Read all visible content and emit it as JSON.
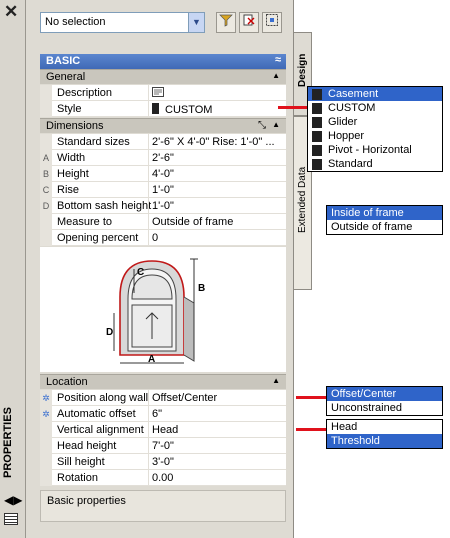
{
  "palette": {
    "header_blue": "#4a76c4",
    "highlight": "#2f64c9",
    "callout_red": "#e0121c",
    "panel_bg": "#dedbd3"
  },
  "titlebar": {
    "close_icon": "close-icon",
    "title": "PROPERTIES"
  },
  "toolbar": {
    "selection_value": "No selection",
    "icons": [
      "quick-select-icon",
      "toggle-pickadd-icon",
      "select-objects-icon"
    ]
  },
  "basic_header": "BASIC",
  "general": {
    "title": "General",
    "rows": [
      {
        "label": "Description",
        "value": ""
      },
      {
        "label": "Style",
        "value": "CUSTOM"
      }
    ]
  },
  "dimensions": {
    "title": "Dimensions",
    "rows": [
      {
        "letter": "",
        "label": "Standard sizes",
        "value": "2'-6\" X 4'-0\"  Rise: 1'-0\"  ..."
      },
      {
        "letter": "A",
        "label": "Width",
        "value": "2'-6\""
      },
      {
        "letter": "B",
        "label": "Height",
        "value": "4'-0\""
      },
      {
        "letter": "C",
        "label": "Rise",
        "value": "1'-0\""
      },
      {
        "letter": "D",
        "label": "Bottom sash height",
        "value": "1'-0\""
      },
      {
        "letter": "",
        "label": "Measure to",
        "value": "Outside of frame"
      },
      {
        "letter": "",
        "label": "Opening percent",
        "value": "0"
      }
    ],
    "diagram_labels": [
      "C",
      "B",
      "D",
      "A"
    ]
  },
  "location": {
    "title": "Location",
    "rows": [
      {
        "label": "Position along wall",
        "value": "Offset/Center"
      },
      {
        "label": "Automatic offset",
        "value": "6\""
      },
      {
        "label": "Vertical alignment",
        "value": "Head"
      },
      {
        "label": "Head height",
        "value": "7'-0\""
      },
      {
        "label": "Sill height",
        "value": "3'-0\""
      },
      {
        "label": "Rotation",
        "value": "0.00"
      }
    ]
  },
  "info_text": "Basic properties",
  "tabs": {
    "design": "Design",
    "extended": "Extended Data"
  },
  "popups": {
    "style": [
      "Casement",
      "CUSTOM",
      "Glider",
      "Hopper",
      "Pivot - Horizontal",
      "Standard"
    ],
    "measure_to": [
      "Inside of frame",
      "Outside of frame"
    ],
    "position": [
      "Offset/Center",
      "Unconstrained"
    ],
    "vertical_alignment": [
      "Head",
      "Threshold"
    ]
  }
}
